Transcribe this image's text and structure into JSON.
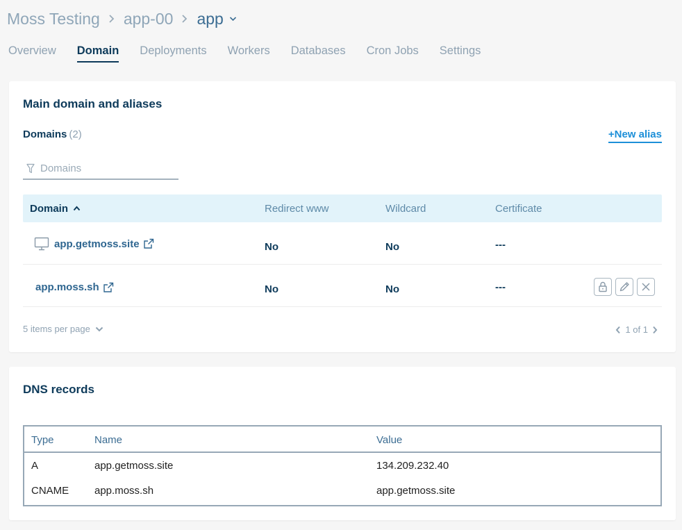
{
  "breadcrumb": {
    "project": "Moss Testing",
    "server": "app-00",
    "site": "app"
  },
  "tabs": [
    "Overview",
    "Domain",
    "Deployments",
    "Workers",
    "Databases",
    "Cron Jobs",
    "Settings"
  ],
  "active_tab": "Domain",
  "main_domain": {
    "title": "Main domain and aliases",
    "domains_label": "Domains",
    "domains_count": "(2)",
    "new_alias": "+New alias",
    "filter_placeholder": "Domains",
    "columns": [
      "Domain",
      "Redirect www",
      "Wildcard",
      "Certificate"
    ],
    "rows": [
      {
        "domain": "app.getmoss.site",
        "redirect_www": "No",
        "wildcard": "No",
        "certificate": "---",
        "is_main": true
      },
      {
        "domain": "app.moss.sh",
        "redirect_www": "No",
        "wildcard": "No",
        "certificate": "---",
        "is_main": false
      }
    ],
    "per_page": "5 items per page",
    "pagination": "1 of 1"
  },
  "dns": {
    "title": "DNS records",
    "columns": [
      "Type",
      "Name",
      "Value"
    ],
    "rows": [
      {
        "type": "A",
        "name": "app.getmoss.site",
        "value": "134.209.232.40"
      },
      {
        "type": "CNAME",
        "name": "app.moss.sh",
        "value": "app.getmoss.site"
      }
    ]
  },
  "colors": {
    "accent": "#1d8fd8",
    "navy": "#0d3a5a",
    "muted": "#8fa2b2",
    "header_bg": "#e2f3fa"
  },
  "icons": [
    "chevron-right-icon",
    "chevron-down-icon",
    "filter-icon",
    "sort-up-icon",
    "monitor-icon",
    "external-link-icon",
    "lock-icon",
    "edit-icon",
    "close-icon",
    "chevron-left-icon"
  ]
}
